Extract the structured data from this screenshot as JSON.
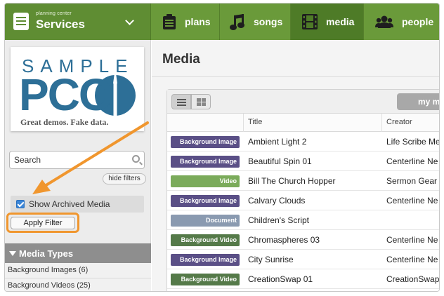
{
  "brand": {
    "small": "planning center",
    "name": "Services"
  },
  "nav": [
    {
      "label": "plans",
      "icon": "clipboard-icon"
    },
    {
      "label": "songs",
      "icon": "music-note-icon"
    },
    {
      "label": "media",
      "icon": "film-icon",
      "active": true
    },
    {
      "label": "people",
      "icon": "people-icon"
    }
  ],
  "sidebar": {
    "logo": {
      "top": "SAMPLE",
      "main": "PCO",
      "tagline": "Great demos. Fake data."
    },
    "search_placeholder": "Search",
    "hide_filters": "hide filters",
    "show_archived_label": "Show Archived Media",
    "show_archived_checked": true,
    "apply_filter": "Apply Filter",
    "media_types_title": "Media Types",
    "media_types": [
      "Background Images (6)",
      "Background Videos (25)"
    ]
  },
  "main": {
    "title": "Media",
    "my_media_button": "my me",
    "columns": {
      "title": "Title",
      "creator": "Creator"
    },
    "rows": [
      {
        "type": "Background Image",
        "title": "Ambient Light 2",
        "creator": "Life Scribe Me"
      },
      {
        "type": "Background Image",
        "title": "Beautiful Spin 01",
        "creator": "Centerline Ne"
      },
      {
        "type": "Video",
        "title": "Bill The Church Hopper",
        "creator": "Sermon Gear"
      },
      {
        "type": "Background Image",
        "title": "Calvary Clouds",
        "creator": "Centerline Ne"
      },
      {
        "type": "Document",
        "title": "Children's Script",
        "creator": ""
      },
      {
        "type": "Background Video",
        "title": "Chromaspheres 03",
        "creator": "Centerline Ne"
      },
      {
        "type": "Background Image",
        "title": "City Sunrise",
        "creator": "Centerline Ne"
      },
      {
        "type": "Background Video",
        "title": "CreationSwap 01",
        "creator": "CreationSwap"
      }
    ]
  },
  "colors": {
    "nav_green": "#6a9a3a",
    "highlight_orange": "#f0962e",
    "badge_background_image": "#5a4f86",
    "badge_video": "#7bab5b",
    "badge_background_video": "#557a49",
    "badge_document": "#8a9ab0"
  }
}
